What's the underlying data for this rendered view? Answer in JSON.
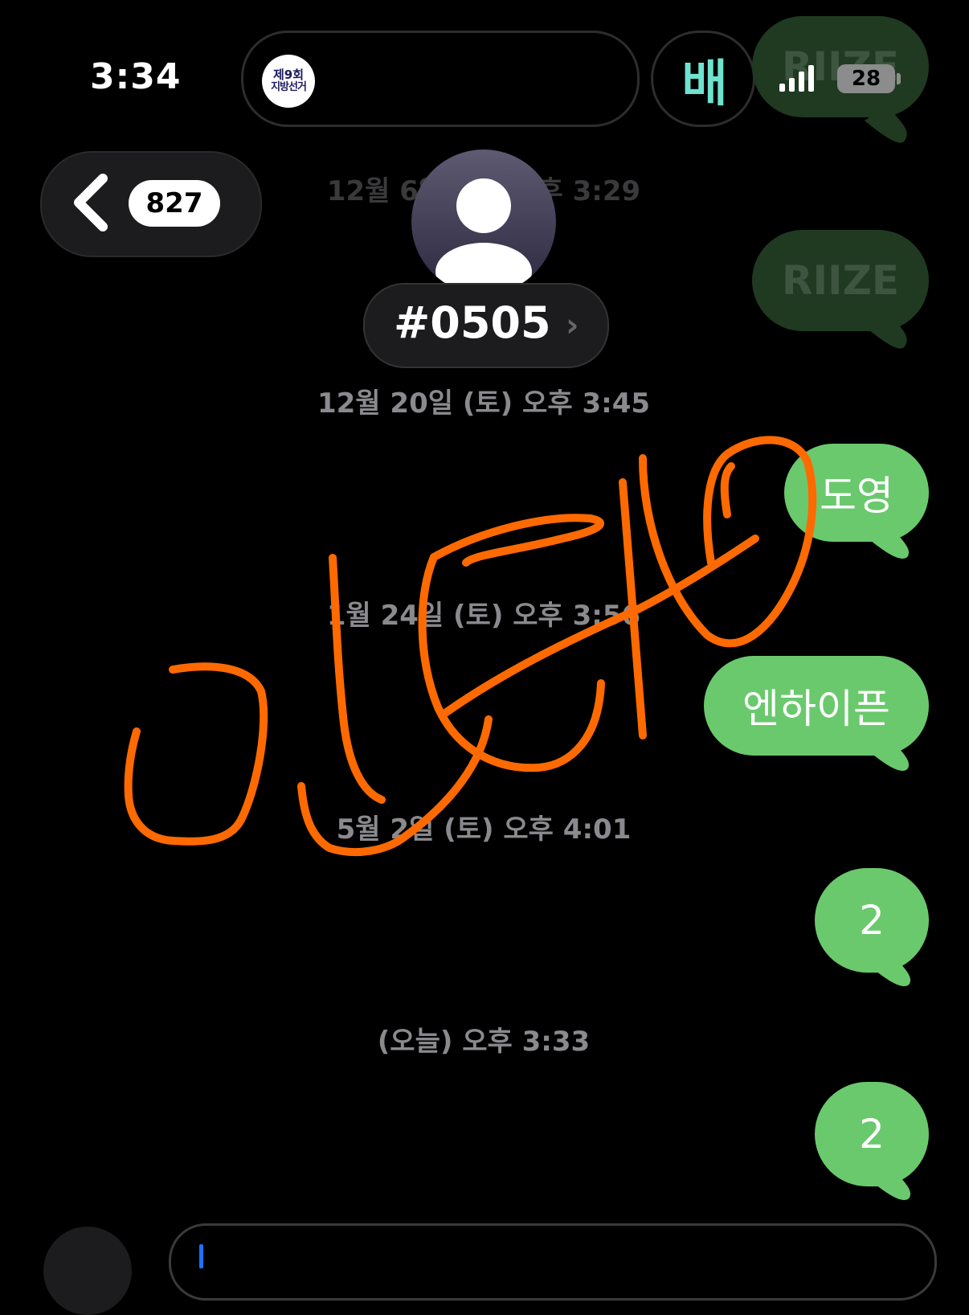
{
  "status_bar": {
    "time": "3:34",
    "election_badge_line1": "제9회",
    "election_badge_line2": "지방선거",
    "app_glyph": "배",
    "signal_icon": "cellular-signal-icon",
    "battery_level": "28"
  },
  "header": {
    "back_badge_count": "827",
    "contact_name": "#0505",
    "contact_chevron": "›",
    "avatar_icon": "person-icon"
  },
  "timestamps": {
    "t0": "12월 6일 (토) 오후 3:29",
    "t1": "12월 20일 (토) 오후 3:45",
    "t2": "1월 24일 (토) 오후 3:56",
    "t3": "5월 2일 (토) 오후 4:01",
    "t4": "(오늘) 오후 3:33"
  },
  "messages": {
    "m0": "RIIZE",
    "m1": "RIIZE",
    "m2": "도영",
    "m3": "엔하이픈",
    "m4": "2",
    "m5": "2"
  },
  "colors": {
    "bubble_green": "#6ac96c",
    "drawing_orange": "#ff6a00",
    "app_teal": "#6ee3cf"
  },
  "annotation": {
    "type": "hand-drawn-scribble",
    "color": "#ff6a00"
  }
}
